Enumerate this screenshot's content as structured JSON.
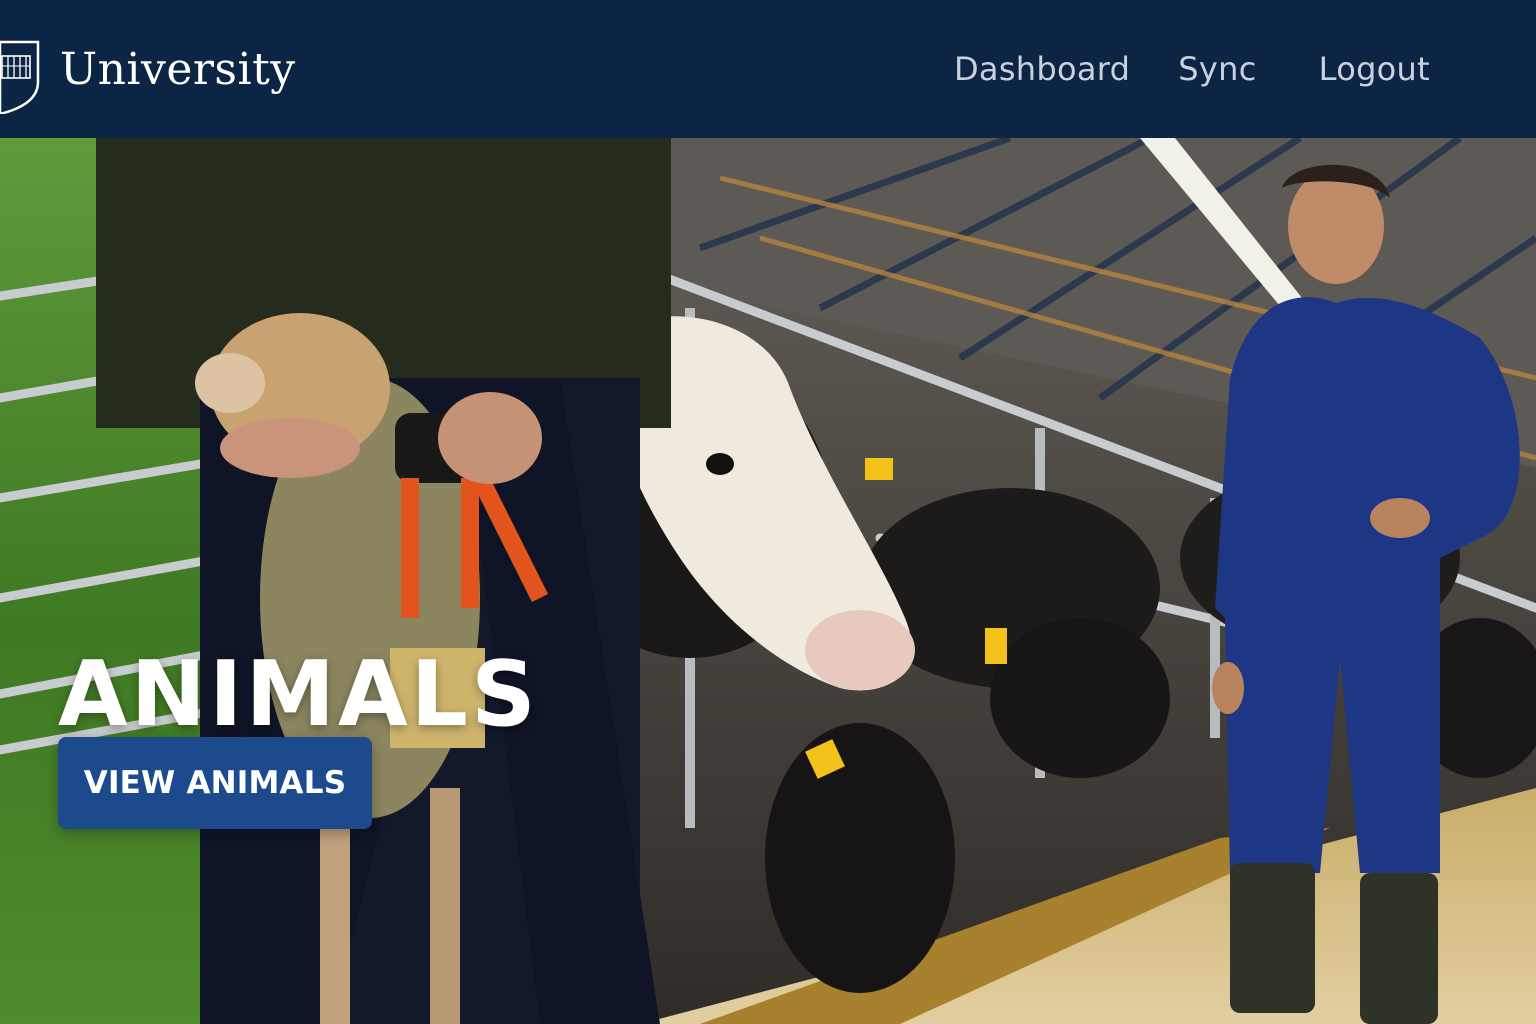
{
  "header": {
    "brand": "University",
    "logo_icon": "shield-icon",
    "nav": [
      {
        "label": "Dashboard"
      },
      {
        "label": "Sync"
      },
      {
        "label": "Logout"
      }
    ]
  },
  "hero": {
    "title": "ANIMALS",
    "cta_label": "VIEW ANIMALS",
    "image": "farm-livestock-photo"
  },
  "colors": {
    "header_bg": "#0c2544",
    "nav_text": "#c9d1dc",
    "button_bg": "#1c4a8c",
    "text_white": "#ffffff"
  }
}
